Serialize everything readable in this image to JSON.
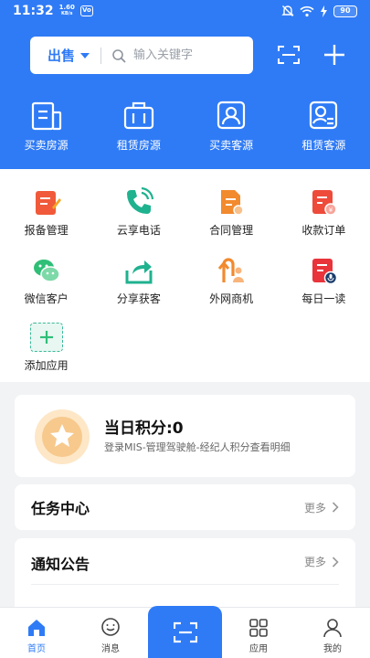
{
  "status_bar": {
    "time": "11:32",
    "network_speed": "1.60",
    "network_unit": "KB/s",
    "badge": "Vo",
    "battery": "90"
  },
  "search": {
    "mode": "出售",
    "placeholder": "输入关键字"
  },
  "quick_actions": [
    {
      "label": "买卖房源",
      "icon": "sale-listing-icon"
    },
    {
      "label": "租赁房源",
      "icon": "rental-listing-icon"
    },
    {
      "label": "买卖客源",
      "icon": "buyer-client-icon"
    },
    {
      "label": "租赁客源",
      "icon": "tenant-client-icon"
    }
  ],
  "apps": [
    {
      "label": "报备管理",
      "icon": "report-icon",
      "color": "#f05a3a"
    },
    {
      "label": "云享电话",
      "icon": "phone-icon",
      "color": "#1fb28f"
    },
    {
      "label": "合同管理",
      "icon": "contract-icon",
      "color": "#f28a2e"
    },
    {
      "label": "收款订单",
      "icon": "payment-order-icon",
      "color": "#ee4b3b"
    },
    {
      "label": "微信客户",
      "icon": "wechat-icon",
      "color": "#2fbf77"
    },
    {
      "label": "分享获客",
      "icon": "share-icon",
      "color": "#1fb28f"
    },
    {
      "label": "外网商机",
      "icon": "opportunity-icon",
      "color": "#f28a2e"
    },
    {
      "label": "每日一读",
      "icon": "daily-read-icon",
      "color": "#e8343a"
    },
    {
      "label": "添加应用",
      "icon": "add-icon",
      "color": "#2fbf77"
    }
  ],
  "points": {
    "title": "当日积分:0",
    "subtitle": "登录MIS-管理驾驶舱-经纪人积分查看明细"
  },
  "task_center": {
    "title": "任务中心",
    "more": "更多"
  },
  "notice": {
    "title": "通知公告",
    "more": "更多"
  },
  "bottom_nav": {
    "home": "首页",
    "messages": "消息",
    "apps": "应用",
    "mine": "我的"
  },
  "colors": {
    "brand_blue": "#2f7bf6",
    "background": "#f2f3f5"
  }
}
